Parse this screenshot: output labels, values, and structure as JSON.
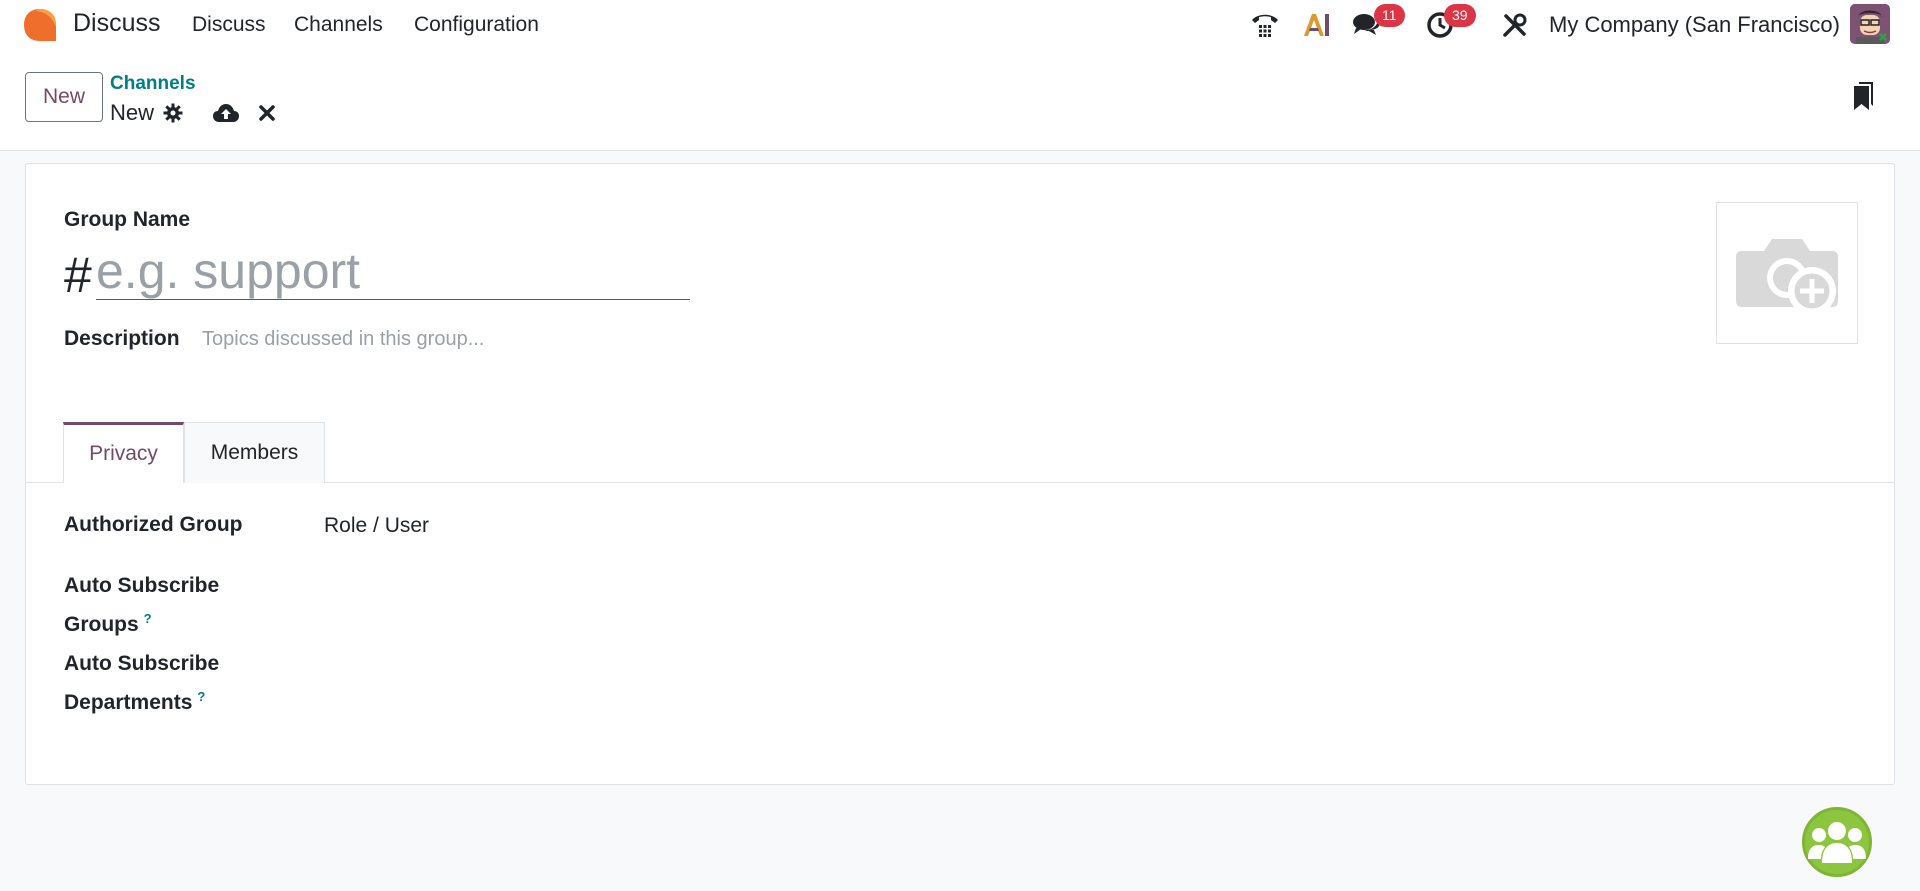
{
  "navbar": {
    "app_name": "Discuss",
    "menus": [
      "Discuss",
      "Channels",
      "Configuration"
    ],
    "messages_count": "11",
    "activities_count": "39",
    "company": "My Company (San Francisco)"
  },
  "control_panel": {
    "new_label": "New",
    "breadcrumb": "Channels",
    "record_name": "New"
  },
  "form": {
    "group_name_label": "Group Name",
    "hash": "#",
    "name_placeholder": "e.g. support",
    "description_label": "Description",
    "description_placeholder": "Topics discussed in this group...",
    "tabs": [
      "Privacy",
      "Members"
    ],
    "authorized_group_label": "Authorized Group",
    "authorized_group_value": "Role / User",
    "auto_subscribe_groups_line1": "Auto Subscribe",
    "auto_subscribe_groups_line2": "Groups",
    "auto_subscribe_departments_line1": "Auto Subscribe",
    "auto_subscribe_departments_line2": "Departments",
    "help_mark": "?"
  },
  "colors": {
    "brand": "#714b67",
    "link": "#017e84",
    "badge": "#dc3545"
  }
}
